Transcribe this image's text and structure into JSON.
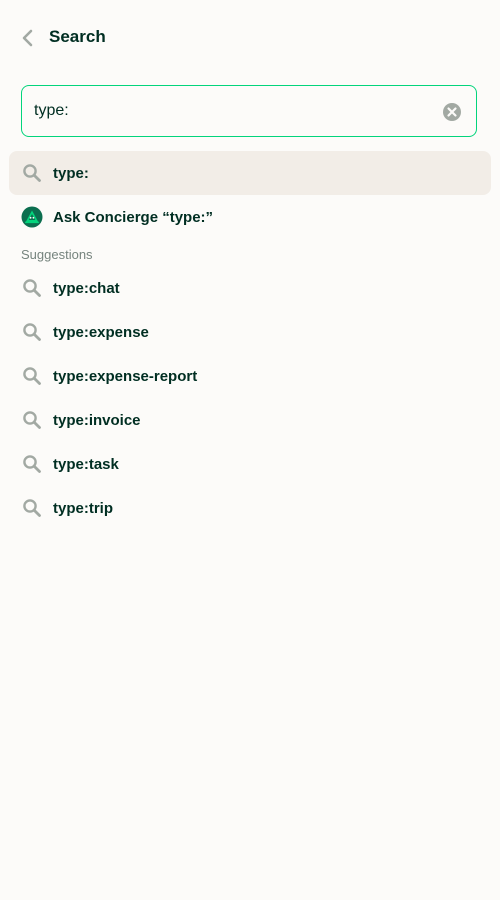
{
  "header": {
    "title": "Search"
  },
  "search": {
    "value": "type:",
    "placeholder": ""
  },
  "top_results": [
    {
      "label": "type:",
      "icon": "search-icon",
      "highlighted": true
    },
    {
      "label": "Ask Concierge “type:”",
      "icon": "concierge-avatar-icon",
      "highlighted": false
    }
  ],
  "suggestions": {
    "heading": "Suggestions",
    "items": [
      {
        "label": "type:chat"
      },
      {
        "label": "type:expense"
      },
      {
        "label": "type:expense-report"
      },
      {
        "label": "type:invoice"
      },
      {
        "label": "type:task"
      },
      {
        "label": "type:trip"
      }
    ]
  },
  "colors": {
    "background": "#FCFBF9",
    "text": "#002E22",
    "accent": "#03D47C",
    "highlight_row": "#F2EDE7",
    "icon_gray": "#A2A9A3",
    "muted_text": "#76847E"
  }
}
